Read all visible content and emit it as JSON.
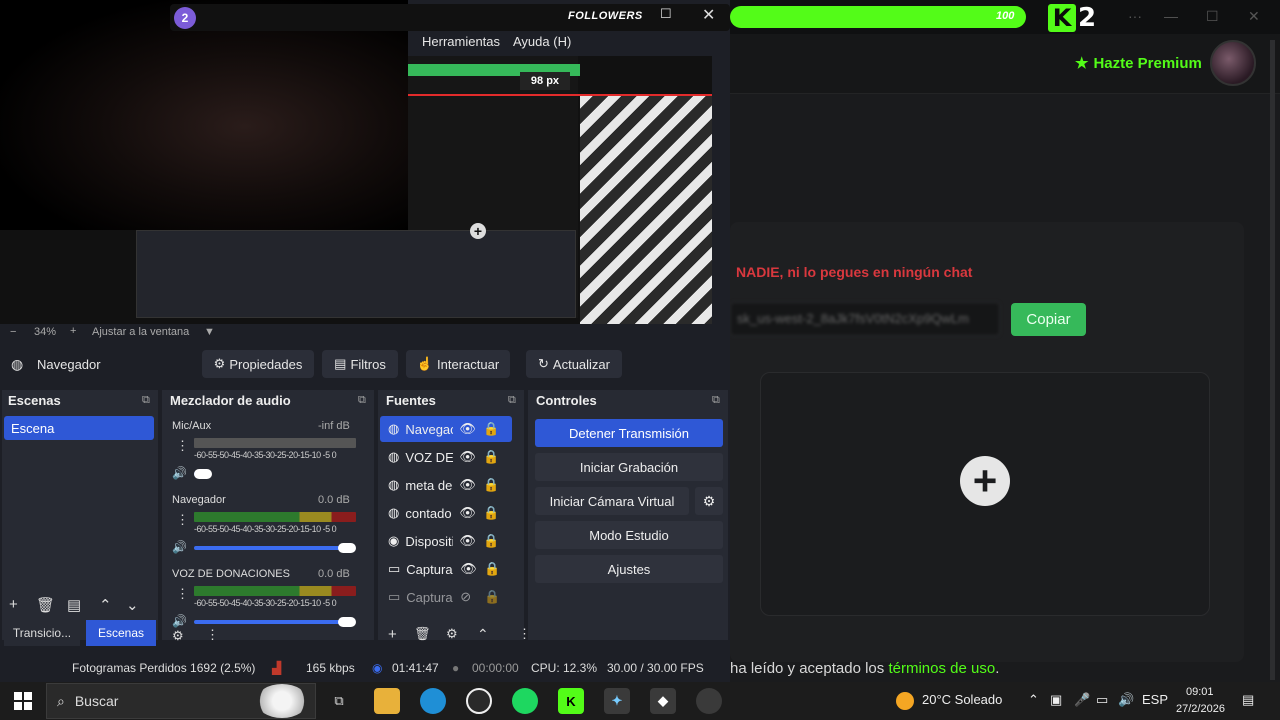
{
  "overlay": {
    "badge": "2",
    "title": "FOLLOWERS",
    "progress_value": "100",
    "progress_fraction": 1.0,
    "min_glyph": "☐",
    "close_glyph": "✕"
  },
  "kick": {
    "premium_label": "Hazte Premium",
    "warning": "NADIE, ni lo pegues en ningún chat",
    "key_value": "sk_us-west-2_8aJk7fsV0tN2cXp9QwLm",
    "copy_label": "Copiar",
    "terms_prefix": "ha leído y aceptado los ",
    "terms_link": "términos de uso",
    "terms_suffix": ".",
    "colors": {
      "accent": "#53fc18",
      "warning": "#d9383e",
      "button": "#36b95a"
    }
  },
  "obs": {
    "menu": [
      "Herramientas",
      "Ayuda (H)"
    ],
    "preview_px_label": "98 px",
    "zoom": {
      "minus": "−",
      "value": "34%",
      "plus": "+",
      "fit": "Ajustar a la ventana"
    },
    "source_bar": {
      "selected": "Navegador",
      "buttons": [
        "Propiedades",
        "Filtros",
        "Interactuar",
        "Actualizar"
      ]
    },
    "docks": {
      "scenes_title": "Escenas",
      "mixer_title": "Mezclador de audio",
      "sources_title": "Fuentes",
      "controls_title": "Controles"
    },
    "scenes": [
      "Escena"
    ],
    "scene_tabs": [
      "Transicio...",
      "Escenas"
    ],
    "mixer": [
      {
        "name": "Mic/Aux",
        "db": "-inf dB",
        "level": 0.0,
        "volume": 0.0
      },
      {
        "name": "Navegador",
        "db": "0.0 dB",
        "level": 0.9,
        "volume": 1.0
      },
      {
        "name": "VOZ DE DONACIONES",
        "db": "0.0 dB",
        "level": 0.9,
        "volume": 1.0
      }
    ],
    "meter_scale": "-60-55-50-45-40-35-30-25-20-15-10 -5  0",
    "sources": [
      {
        "name": "Navegac",
        "icon": "globe-icon",
        "visible": true,
        "locked": false,
        "selected": true
      },
      {
        "name": "VOZ DE I",
        "icon": "globe-icon",
        "visible": true,
        "locked": true
      },
      {
        "name": "meta de",
        "icon": "globe-icon",
        "visible": true,
        "locked": true
      },
      {
        "name": "contado",
        "icon": "globe-icon",
        "visible": true,
        "locked": false
      },
      {
        "name": "Dispositi",
        "icon": "camera-icon",
        "visible": true,
        "locked": true
      },
      {
        "name": "Captura",
        "icon": "monitor-icon",
        "visible": true,
        "locked": true
      },
      {
        "name": "Captura",
        "icon": "monitor-icon",
        "visible": false,
        "locked": true
      }
    ],
    "controls": {
      "stop_stream": "Detener Transmisión",
      "start_recording": "Iniciar Grabación",
      "start_virtual_cam": "Iniciar Cámara Virtual",
      "studio_mode": "Modo Estudio",
      "settings": "Ajustes"
    },
    "status": {
      "dropped_frames": "Fotogramas Perdidos 1692 (2.5%)",
      "bitrate": "165 kbps",
      "stream_time": "01:41:47",
      "record_time": "00:00:00",
      "cpu": "CPU: 12.3%",
      "fps": "30.00 / 30.00 FPS"
    },
    "colors": {
      "selected": "#2f58d6",
      "dock": "#272a33"
    }
  },
  "taskbar": {
    "search_placeholder": "Buscar",
    "weather": "20°C  Soleado",
    "language": "ESP",
    "time": "09:01",
    "date": "27/2/2026"
  }
}
